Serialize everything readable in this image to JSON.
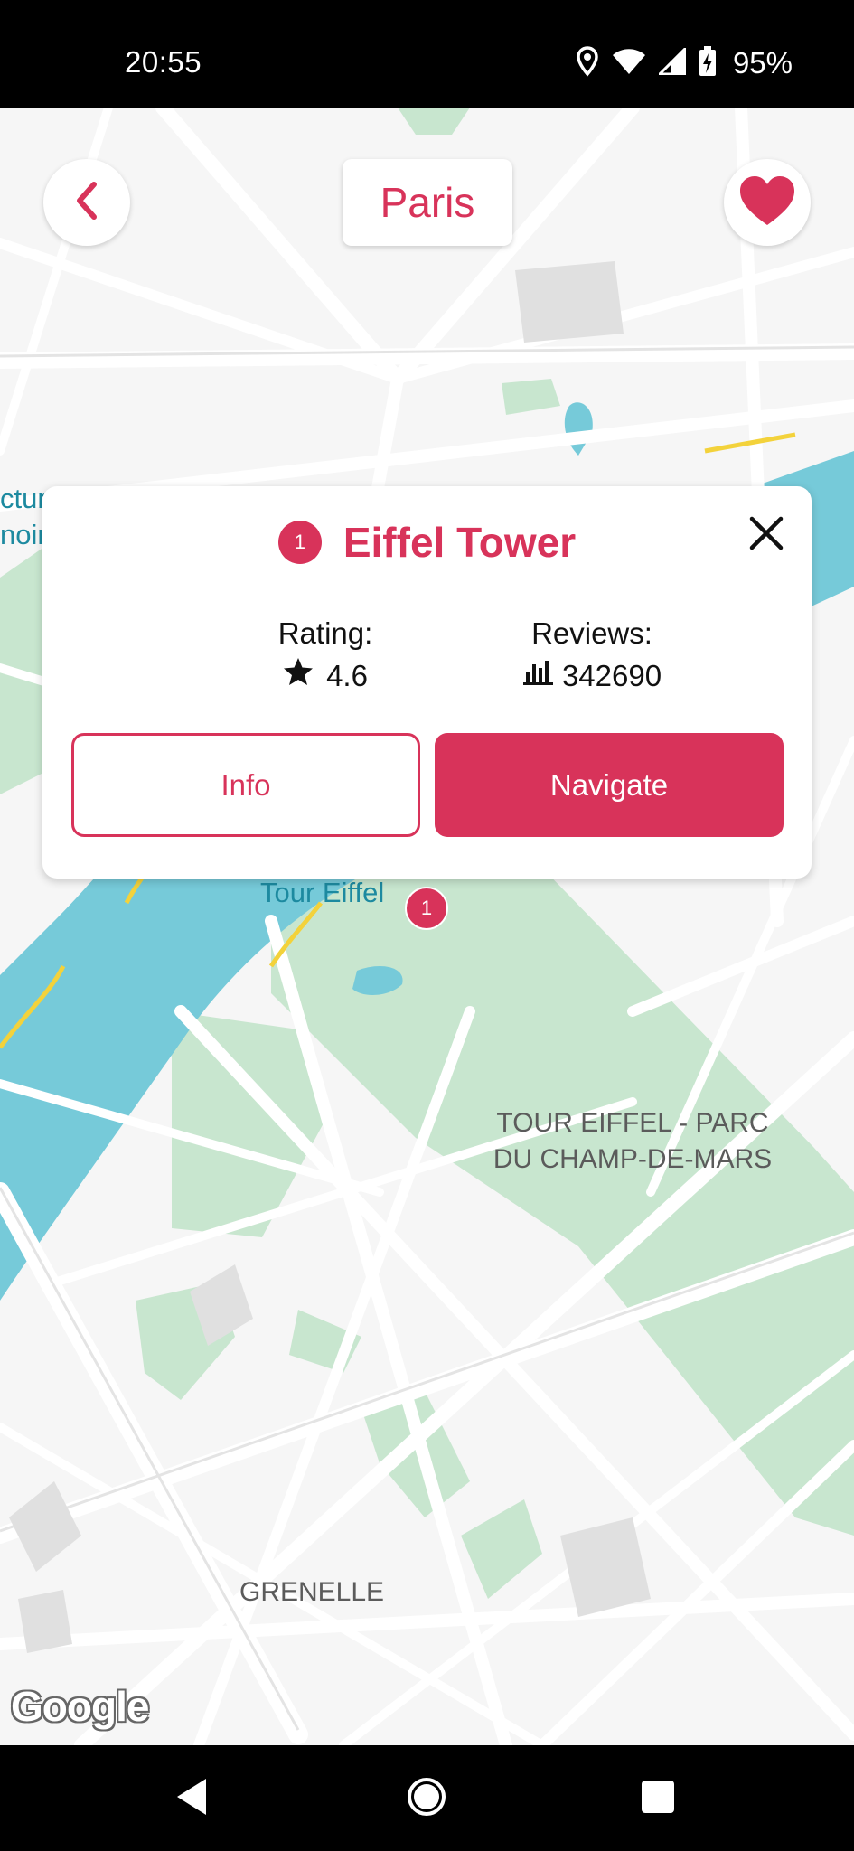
{
  "status_bar": {
    "time": "20:55",
    "battery": "95%",
    "icons": [
      "location-icon",
      "wifi-icon",
      "cell-signal-icon",
      "battery-charging-icon"
    ]
  },
  "header": {
    "back_icon": "chevron-left-icon",
    "city": "Paris",
    "favorite_icon": "heart-icon",
    "favorite_active": true
  },
  "place_card": {
    "badge": "1",
    "title": "Eiffel Tower",
    "close_icon": "close-icon",
    "rating_label": "Rating:",
    "rating_value": "4.6",
    "rating_icon": "star-icon",
    "reviews_label": "Reviews:",
    "reviews_value": "342690",
    "reviews_icon": "bar-chart-icon",
    "info_button": "Info",
    "navigate_button": "Navigate"
  },
  "map": {
    "marker_label": "1",
    "labels": {
      "tour_eiffel": "Tour Eiffel",
      "park_line1": "TOUR EIFFEL - PARC",
      "park_line2": "DU CHAMP-DE-MARS",
      "grenelle": "GRENELLE",
      "side_left_1": "ctur",
      "side_left_2": "noir"
    },
    "attribution": "Google"
  },
  "nav_bar": {
    "back_icon": "nav-back-icon",
    "home_icon": "nav-home-icon",
    "recents_icon": "nav-recents-icon"
  },
  "colors": {
    "accent": "#d8335a",
    "water": "#76cad9",
    "park": "#c8e6cf",
    "road": "#ffffff",
    "land": "#f6f6f6"
  }
}
